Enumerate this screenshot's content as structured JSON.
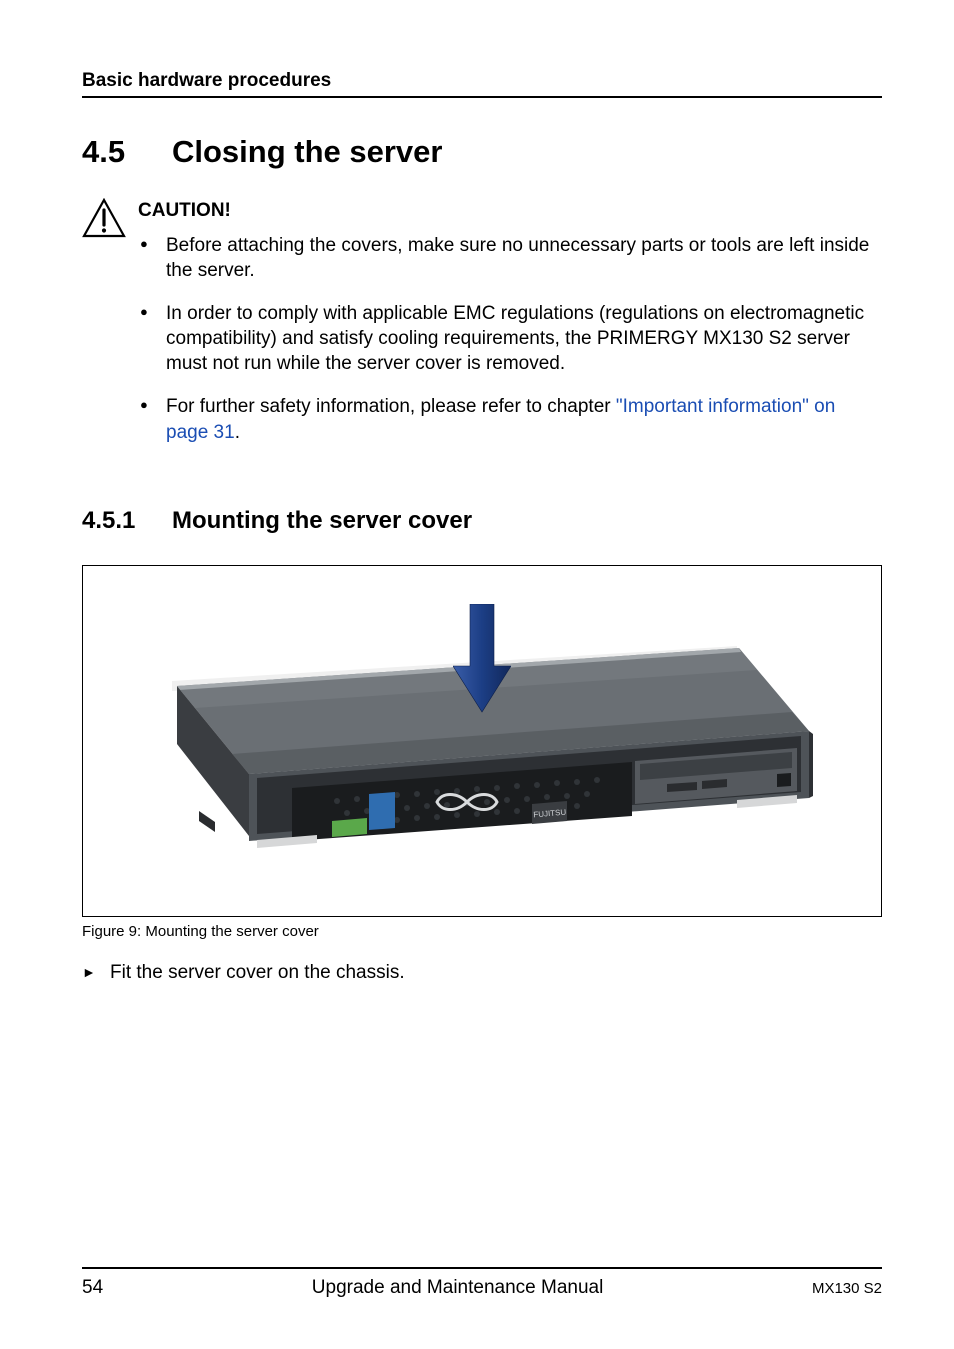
{
  "header": {
    "section_title": "Basic hardware procedures"
  },
  "h1": {
    "number": "4.5",
    "title": "Closing the server"
  },
  "caution": {
    "title": "CAUTION!",
    "items": [
      {
        "text": "Before attaching the covers, make sure no unnecessary parts or tools are left inside the server."
      },
      {
        "text": "In order to comply with applicable EMC regulations (regulations on electromagnetic compatibility) and satisfy cooling requirements, the PRIMERGY MX130 S2 server must not run while the server cover is removed."
      },
      {
        "prefix": "For further safety information, please refer to chapter ",
        "link": "\"Important information\" on page 31",
        "suffix": "."
      }
    ]
  },
  "h2": {
    "number": "4.5.1",
    "title": "Mounting the server cover"
  },
  "figure": {
    "caption": "Figure 9: Mounting the server cover"
  },
  "steps": [
    "Fit the server cover on the chassis."
  ],
  "footer": {
    "page": "54",
    "center": "Upgrade and Maintenance Manual",
    "right": "MX130 S2"
  },
  "icons": {
    "caution_icon": "caution-triangle-icon",
    "arrow_icon": "arrow-down-icon"
  }
}
